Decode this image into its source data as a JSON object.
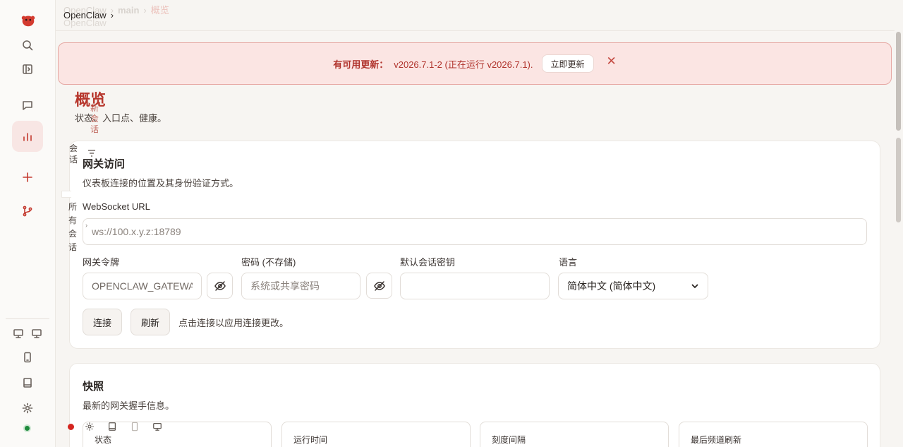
{
  "breadcrumb": {
    "ghost": [
      "OpenClaw",
      "main",
      "概览"
    ],
    "main": "OpenClaw",
    "ghost2": "OpenClaw"
  },
  "banner": {
    "prefix": "有可用更新：",
    "version_text": "v2026.7.1-2 (正在运行 v2026.7.1).",
    "update_button": "立即更新",
    "close_symbol": "✕"
  },
  "page": {
    "title": "概览",
    "subtitle": "状态、入口点、健康。"
  },
  "overlays": {
    "new_session": "新会话",
    "session": "会话",
    "all_sessions": "所有会话"
  },
  "gateway": {
    "title": "网关访问",
    "description": "仪表板连接的位置及其身份验证方式。",
    "ws_label": "WebSocket URL",
    "ws_placeholder": "ws://100.x.y.z:18789",
    "token_label": "网关令牌",
    "token_value": "OPENCLAW_GATEWAY_TOKEN",
    "password_label": "密码 (不存储)",
    "password_placeholder": "系统或共享密码",
    "session_key_label": "默认会话密钥",
    "session_key_value": "",
    "language_label": "语言",
    "language_value": "简体中文 (简体中文)",
    "connect_button": "连接",
    "refresh_button": "刷新",
    "hint": "点击连接以应用连接更改。"
  },
  "snapshot": {
    "title": "快照",
    "description": "最新的网关握手信息。",
    "stats": [
      "状态",
      "运行时间",
      "刻度间隔",
      "最后频道刷新"
    ]
  },
  "colors": {
    "accent": "#b7372d",
    "banner_bg": "#fbe5e3",
    "status_online": "#1e8a3c",
    "status_error": "#d4251f"
  }
}
